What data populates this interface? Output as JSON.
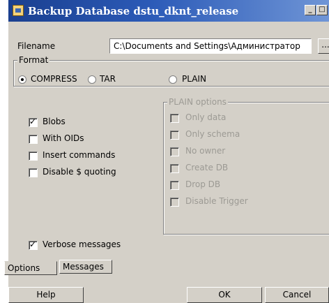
{
  "window": {
    "title": "Backup Database dstu_dknt_release",
    "minimize_glyph": "_",
    "maximize_glyph": "□",
    "close_glyph": "×"
  },
  "filename": {
    "label": "Filename",
    "value": "C:\\Documents and Settings\\Администратор",
    "browse_label": "..."
  },
  "format": {
    "legend": "Format",
    "options": [
      {
        "label": "COMPRESS",
        "selected": true
      },
      {
        "label": "TAR",
        "selected": false
      },
      {
        "label": "PLAIN",
        "selected": false
      }
    ]
  },
  "options": [
    {
      "label": "Blobs",
      "checked": true
    },
    {
      "label": "With OIDs",
      "checked": false
    },
    {
      "label": "Insert commands",
      "checked": false
    },
    {
      "label": "Disable $ quoting",
      "checked": false
    }
  ],
  "plain_options": {
    "legend": "PLAIN options",
    "items": [
      {
        "label": "Only data",
        "checked": false
      },
      {
        "label": "Only schema",
        "checked": false
      },
      {
        "label": "No owner",
        "checked": false
      },
      {
        "label": "Create DB",
        "checked": false
      },
      {
        "label": "Drop DB",
        "checked": false
      },
      {
        "label": "Disable Trigger",
        "checked": false
      }
    ]
  },
  "verbose": {
    "label": "Verbose messages",
    "checked": true
  },
  "tabs": [
    {
      "label": "Options",
      "active": true
    },
    {
      "label": "Messages",
      "active": false
    }
  ],
  "buttons": {
    "help": "Help",
    "ok": "OK",
    "cancel": "Cancel"
  }
}
